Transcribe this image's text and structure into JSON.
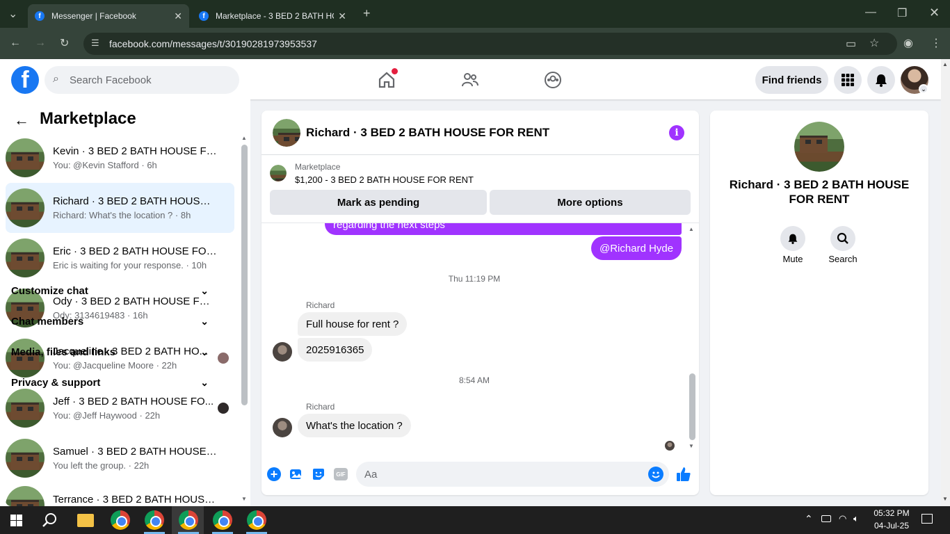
{
  "browser": {
    "tabs": [
      {
        "title": "Messenger | Facebook"
      },
      {
        "title": "Marketplace - 3 BED 2 BATH HO"
      }
    ],
    "url": "facebook.com/messages/t/30190281973953537"
  },
  "fb_header": {
    "search_placeholder": "Search Facebook",
    "find_friends": "Find friends"
  },
  "left_pane": {
    "title": "Marketplace",
    "conversations": [
      {
        "title": "Kevin · 3 BED 2 BATH HOUSE FO...",
        "preview": "You: @Kevin Stafford · 6h"
      },
      {
        "title": "Richard · 3 BED 2 BATH HOUSE ...",
        "preview": "Richard: What's the location ? · 8h"
      },
      {
        "title": "Eric · 3 BED 2 BATH HOUSE FOR ...",
        "preview": "Eric is waiting for your response. · 10h"
      },
      {
        "title": "Ody · 3 BED 2 BATH HOUSE FOR...",
        "preview": "Ody: 3134619483 · 16h"
      },
      {
        "title": "Jacqueline · 3 BED 2 BATH HO...",
        "preview": "You: @Jacqueline Moore · 22h"
      },
      {
        "title": "Jeff · 3 BED 2 BATH HOUSE FO...",
        "preview": "You: @Jeff Haywood · 22h"
      },
      {
        "title": "Samuel · 3 BED 2 BATH HOUSE F...",
        "preview": "You left the group. · 22h"
      },
      {
        "title": "Terrance · 3 BED 2 BATH HOUSE ...",
        "preview": ""
      }
    ]
  },
  "chat": {
    "header_title": "Richard · 3 BED 2 BATH HOUSE FOR RENT",
    "listing_source": "Marketplace",
    "listing_title": "$1,200 - 3 BED 2 BATH HOUSE FOR RENT",
    "mark_pending": "Mark as pending",
    "more_options": "More options",
    "messages": {
      "partial_me": "regarding the next steps",
      "mention_me": "@Richard Hyde",
      "time1": "Thu 11:19 PM",
      "sender1": "Richard",
      "msg1": "Full house for rent ?",
      "msg2": "2025916365",
      "time2": "8:54 AM",
      "sender2": "Richard",
      "msg3": "What's the location ?"
    },
    "composer_placeholder": "Aa"
  },
  "right_pane": {
    "title": "Richard · 3 BED 2 BATH HOUSE FOR RENT",
    "mute": "Mute",
    "search": "Search",
    "sections": [
      "Customize chat",
      "Chat members",
      "Media, files and links",
      "Privacy & support"
    ]
  },
  "taskbar": {
    "time": "05:32 PM",
    "date": "04-Jul-25"
  },
  "colors": {
    "fb_blue": "#1877f2",
    "message_purple": "#a033ff",
    "chrome_green": "#1f2f22"
  }
}
